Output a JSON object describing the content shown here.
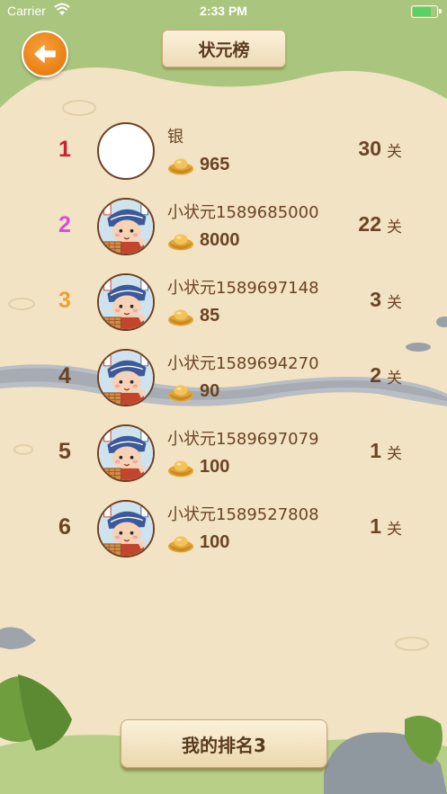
{
  "status_bar": {
    "carrier": "Carrier",
    "time": "2:33 PM"
  },
  "header": {
    "title": "状元榜"
  },
  "rows": [
    {
      "rank": "1",
      "rank_color": "#c7232e",
      "name": "银",
      "coins": "965",
      "level": "30",
      "level_unit": "关",
      "avatar": "blank"
    },
    {
      "rank": "2",
      "rank_color": "#d64fd6",
      "name": "小状元1589685000",
      "coins": "8000",
      "level": "22",
      "level_unit": "关",
      "avatar": "cartoon-boy"
    },
    {
      "rank": "3",
      "rank_color": "#e9a232",
      "name": "小状元1589697148",
      "coins": "85",
      "level": "3",
      "level_unit": "关",
      "avatar": "cartoon-boy"
    },
    {
      "rank": "4",
      "rank_color": "#6b4424",
      "name": "小状元1589694270",
      "coins": "90",
      "level": "2",
      "level_unit": "关",
      "avatar": "cartoon-boy"
    },
    {
      "rank": "5",
      "rank_color": "#6b4424",
      "name": "小状元1589697079",
      "coins": "100",
      "level": "1",
      "level_unit": "关",
      "avatar": "cartoon-boy"
    },
    {
      "rank": "6",
      "rank_color": "#6b4424",
      "name": "小状元1589527808",
      "coins": "100",
      "level": "1",
      "level_unit": "关",
      "avatar": "cartoon-boy"
    }
  ],
  "footer": {
    "my_rank_label": "我的排名3"
  },
  "colors": {
    "text_brown": "#6b4424",
    "accent_orange": "#e97f12",
    "parchment": "#f2e3c4"
  }
}
